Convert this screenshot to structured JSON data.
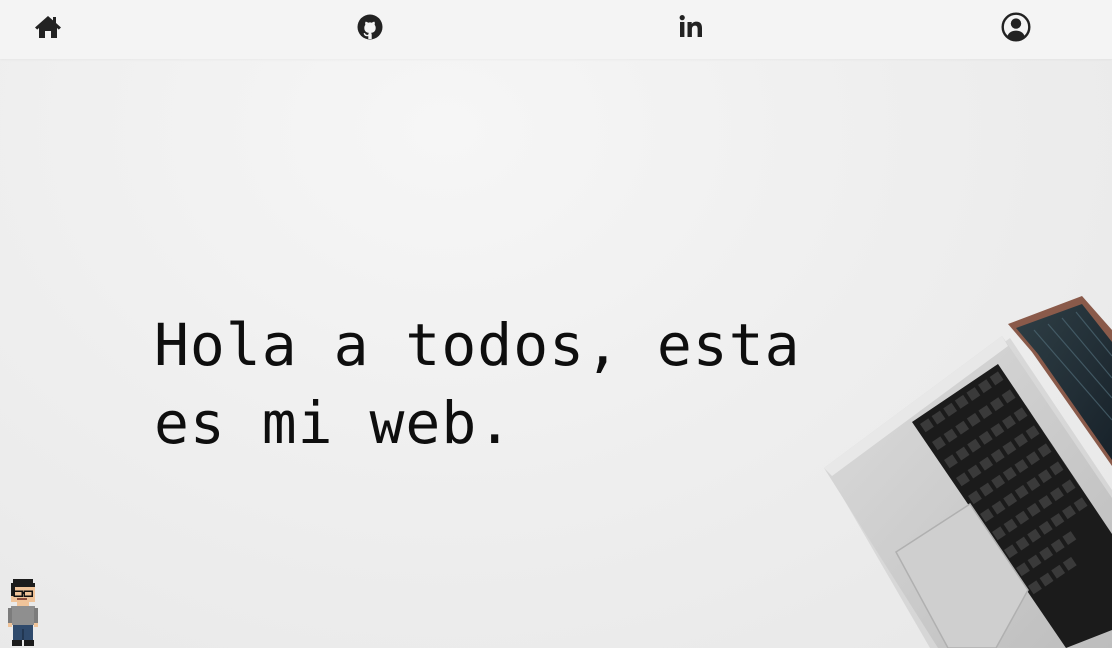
{
  "navbar": {
    "items": [
      {
        "name": "home",
        "icon": "home-icon"
      },
      {
        "name": "github",
        "icon": "github-icon"
      },
      {
        "name": "linkedin",
        "icon": "linkedin-icon",
        "label": "in"
      },
      {
        "name": "profile",
        "icon": "user-circle-icon"
      }
    ]
  },
  "hero": {
    "headline": "Hola a todos, esta es mi web."
  },
  "decor": {
    "laptop": "laptop-image",
    "avatar": "pixel-avatar"
  },
  "colors": {
    "background": "#efefef",
    "navbar": "#f4f4f4",
    "icon": "#222222",
    "text": "#0e0e0e"
  }
}
